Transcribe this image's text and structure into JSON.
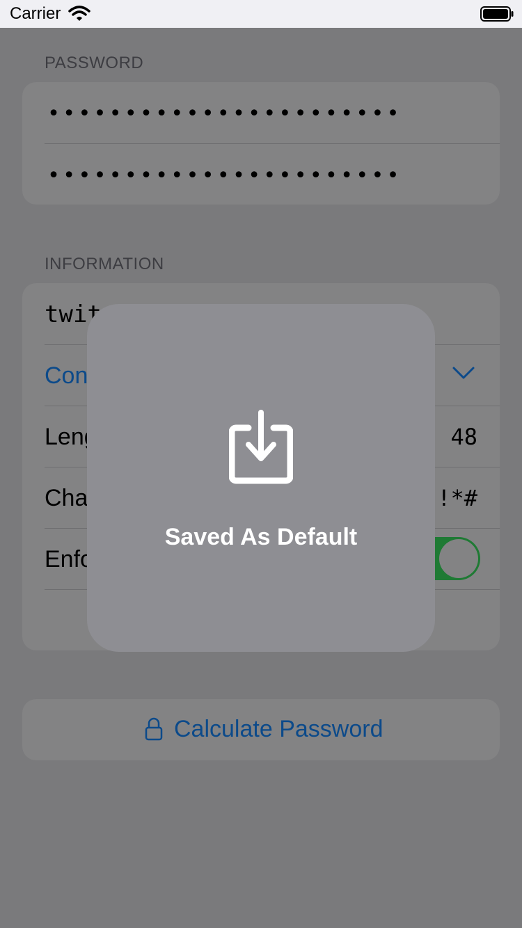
{
  "status_bar": {
    "carrier": "Carrier"
  },
  "password_section": {
    "header": "PASSWORD",
    "field1_masked": "•••••••••••••••••••••••",
    "field2_masked": "•••••••••••••••••••••••"
  },
  "information_section": {
    "header": "INFORMATION",
    "rows": [
      {
        "label": "twit"
      },
      {
        "label": "Con"
      },
      {
        "label": "Leng",
        "value": "48"
      },
      {
        "label": "Cha",
        "value": "!*#"
      },
      {
        "label": "Enfo",
        "toggle_on": true
      }
    ]
  },
  "calculate_button": {
    "label": "Calculate Password"
  },
  "hud": {
    "message": "Saved As Default"
  },
  "colors": {
    "link_blue": "#0c4a8a",
    "toggle_green": "#1f7a34",
    "hud_background": "#8e8e93"
  }
}
